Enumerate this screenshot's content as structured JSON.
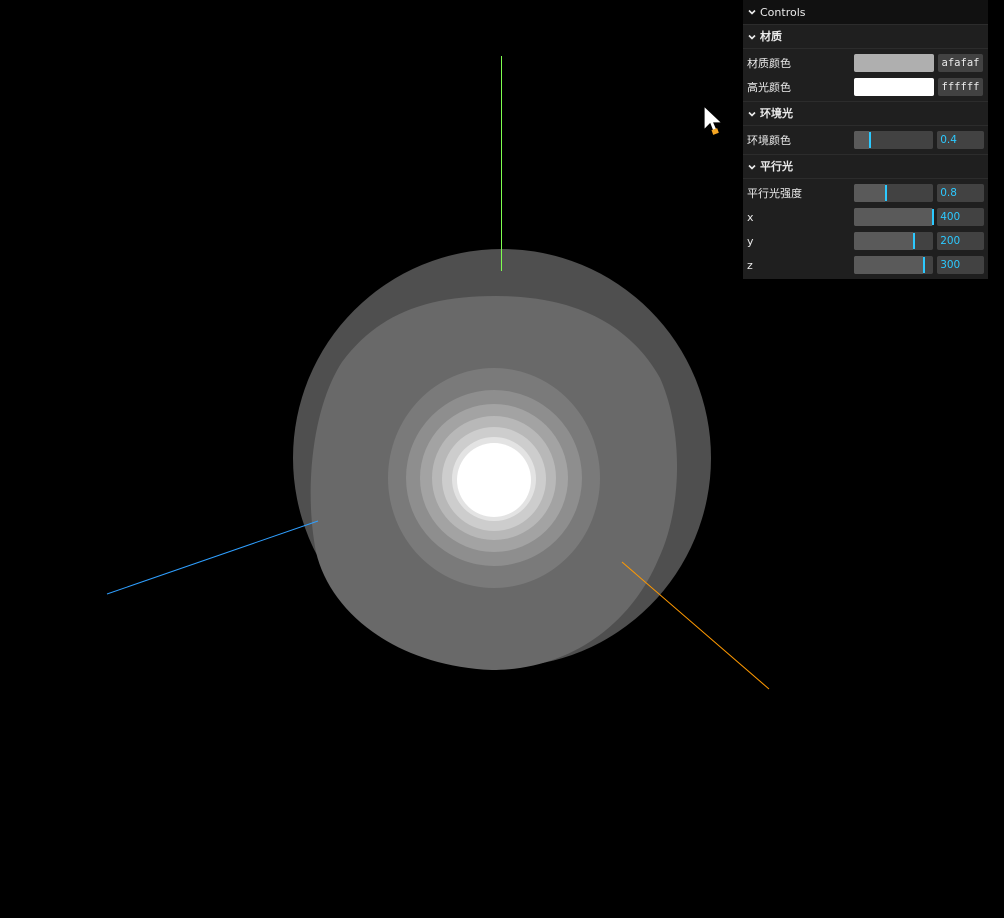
{
  "gui": {
    "title": "Controls",
    "folders": [
      {
        "title": "材质",
        "rows": [
          {
            "label": "材质颜色",
            "type": "color",
            "color": "#afafaf",
            "hex": "afafaf"
          },
          {
            "label": "高光颜色",
            "type": "color",
            "color": "#ffffff",
            "hex": "ffffff"
          }
        ]
      },
      {
        "title": "环境光",
        "rows": [
          {
            "label": "环境颜色",
            "type": "slider",
            "value": "0.4",
            "fraction": 0.2
          }
        ]
      },
      {
        "title": "平行光",
        "rows": [
          {
            "label": "平行光强度",
            "type": "slider",
            "value": "0.8",
            "fraction": 0.4
          },
          {
            "label": "x",
            "type": "slider",
            "value": "400",
            "fraction": 1.0
          },
          {
            "label": "y",
            "type": "slider",
            "value": "200",
            "fraction": 0.75
          },
          {
            "label": "z",
            "type": "slider",
            "value": "300",
            "fraction": 0.875
          }
        ]
      }
    ]
  },
  "scene": {
    "background": "#000000",
    "axis_colors": {
      "x": "#ff9900",
      "y": "#7fff4f",
      "z": "#2f9fff"
    },
    "sphere_shades": [
      "#4f4f4f",
      "#696969",
      "#7a7a7a",
      "#8e8e8e",
      "#a3a3a3",
      "#b8b8b8",
      "#cdcdcd",
      "#e3e3e3",
      "#ffffff"
    ]
  },
  "icons": {
    "chevron": "chevron-down-icon",
    "cursor": "mouse-pointer-icon"
  }
}
